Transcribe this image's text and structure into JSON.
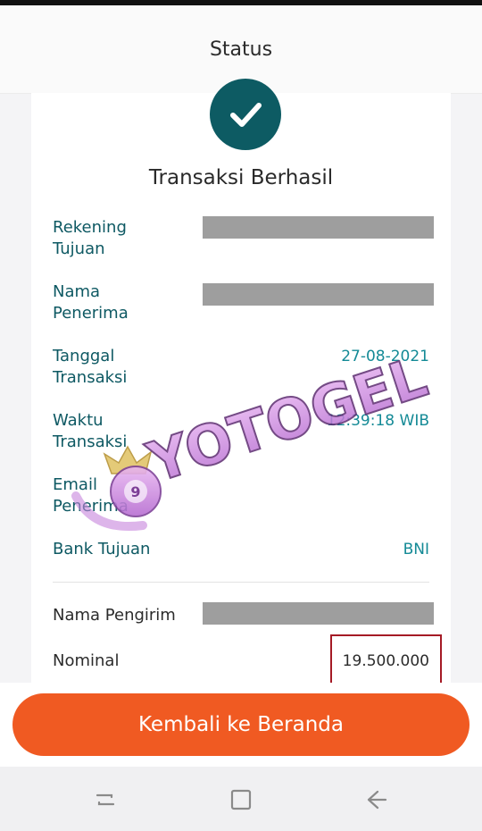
{
  "header": {
    "title": "Status"
  },
  "status": {
    "title": "Transaksi Berhasil"
  },
  "fields": {
    "rekening_tujuan": {
      "label1": "Rekening",
      "label2": "Tujuan"
    },
    "nama_penerima": {
      "label1": "Nama",
      "label2": "Penerima"
    },
    "tanggal_transaksi": {
      "label1": "Tanggal",
      "label2": "Transaksi",
      "value": "27-08-2021"
    },
    "waktu_transaksi": {
      "label1": "Waktu",
      "label2": "Transaksi",
      "value": "12:39:18 WIB"
    },
    "email_penerima": {
      "label1": "Email",
      "label2": "Penerima"
    },
    "bank_tujuan": {
      "label": "Bank Tujuan",
      "value": "BNI"
    },
    "nama_pengirim": {
      "label": "Nama Pengirim"
    },
    "nominal": {
      "label": "Nominal",
      "value": "19.500.000"
    }
  },
  "button": {
    "label": "Kembali ke Beranda"
  },
  "watermark": {
    "text": "YOTOGEL"
  },
  "icons": {
    "check": "check-icon",
    "nav_recent": "recent-apps-icon",
    "nav_home": "home-icon",
    "nav_back": "back-icon"
  },
  "colors": {
    "accent_teal": "#0d5b63",
    "button_orange": "#f05a22",
    "highlight_red": "#a51a25"
  }
}
